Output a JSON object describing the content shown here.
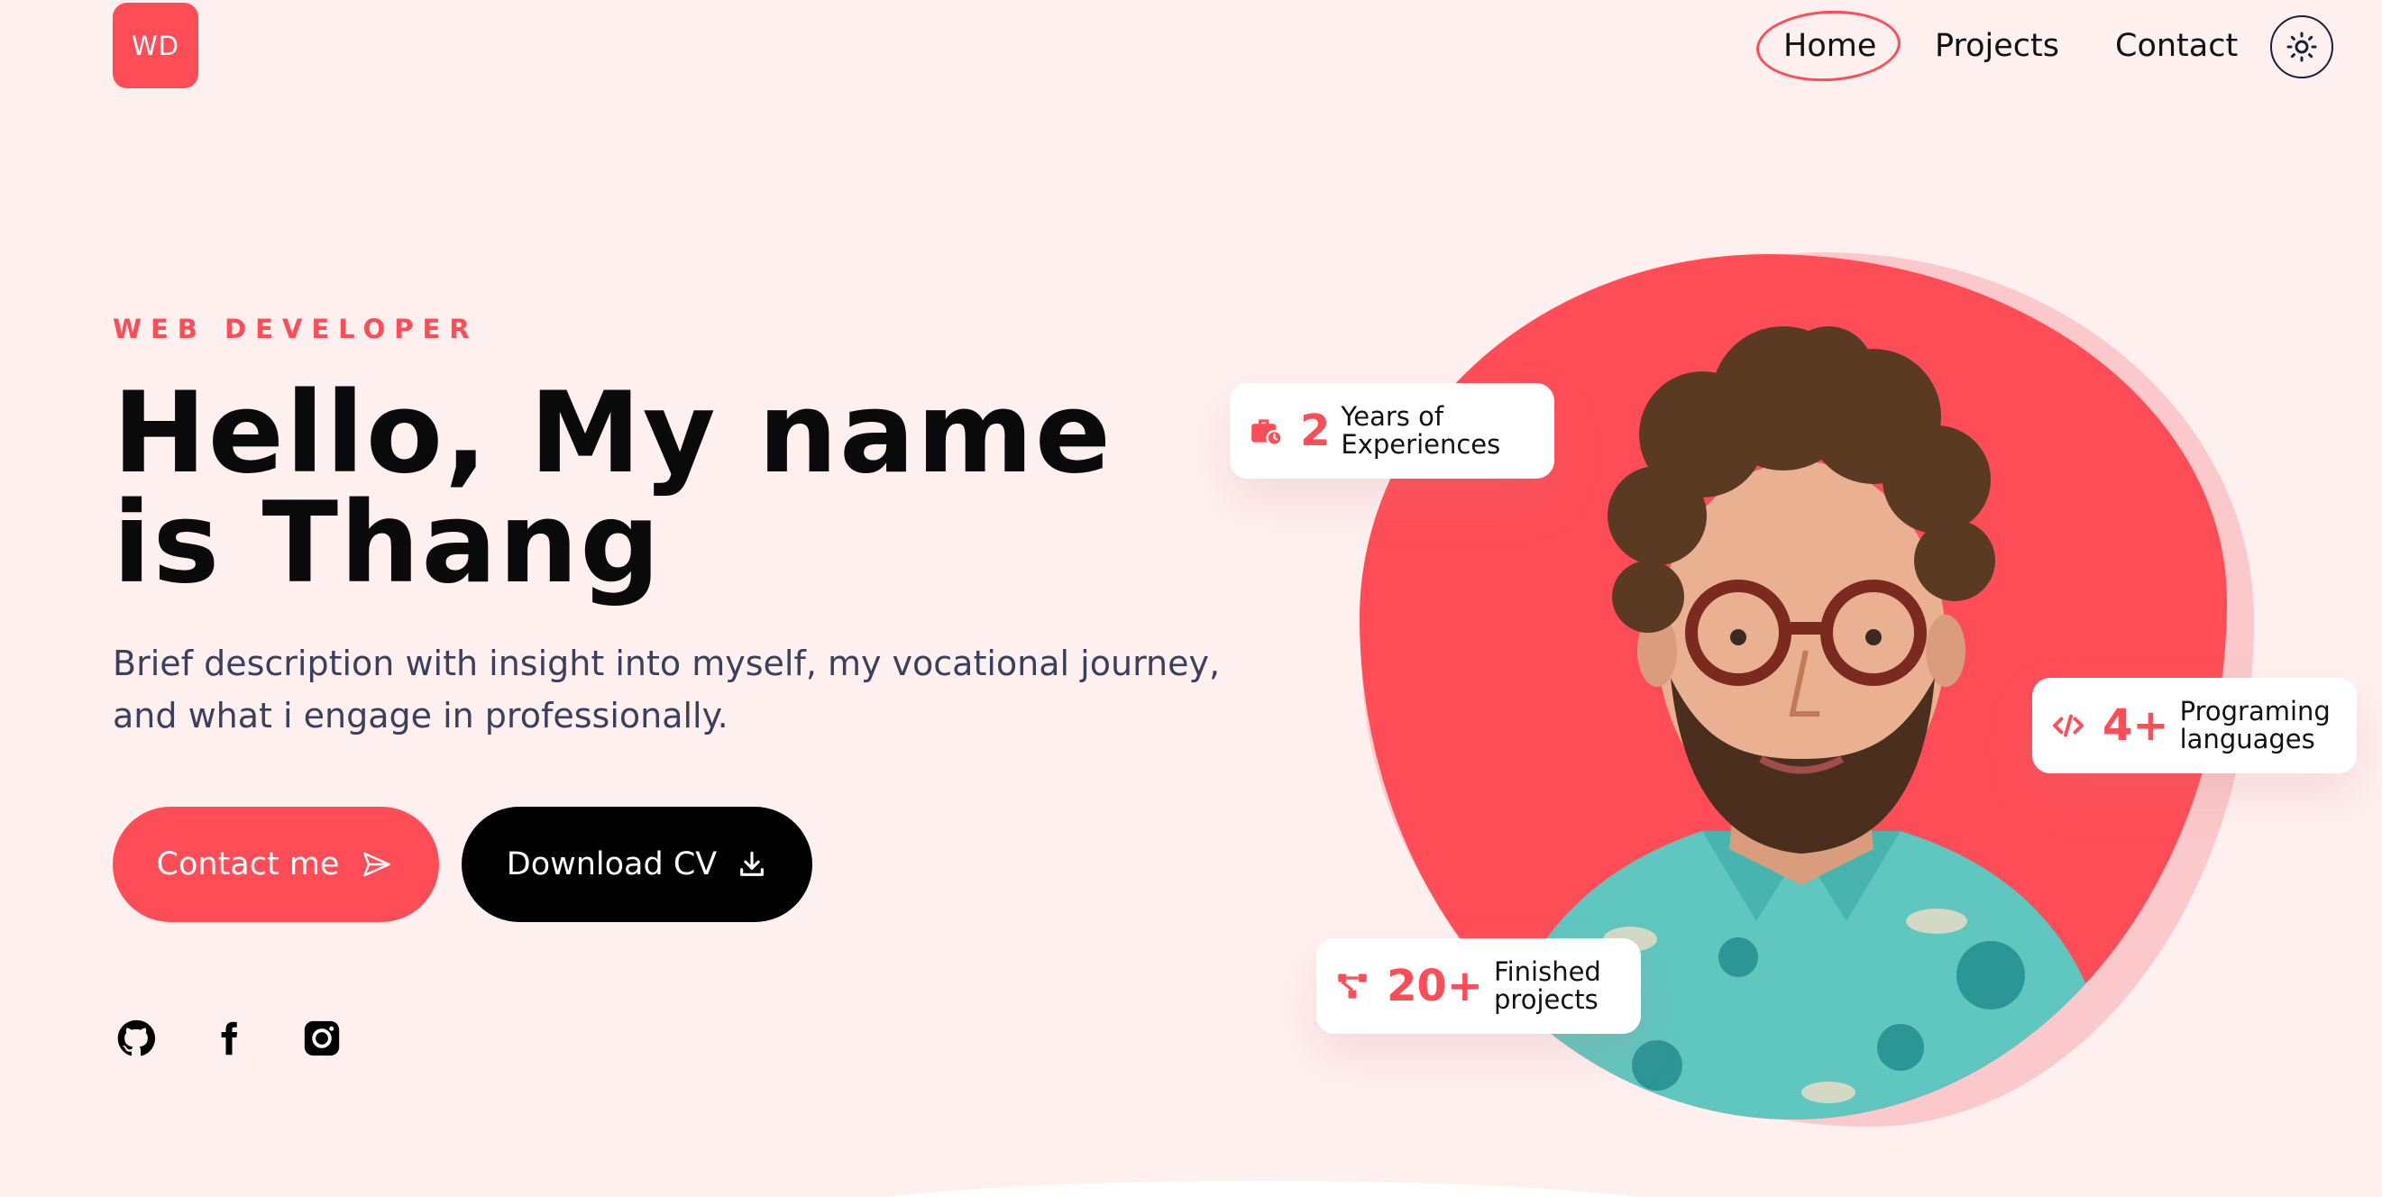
{
  "header": {
    "logo": "WD",
    "nav": [
      {
        "label": "Home",
        "active": true
      },
      {
        "label": "Projects"
      },
      {
        "label": "Contact"
      }
    ],
    "theme_icon": "sun-icon"
  },
  "hero": {
    "eyebrow": "WEB DEVELOPER",
    "headline_line1": "Hello, My name",
    "headline_line2": "is Thang",
    "description_line1": "Brief description with insight into myself, my vocational journey,",
    "description_line2": "and what i engage in professionally.",
    "buttons": {
      "contact": {
        "label": "Contact me",
        "icon": "paper-plane-icon"
      },
      "cv": {
        "label": "Download CV",
        "icon": "download-icon"
      }
    },
    "socials": [
      {
        "name": "github",
        "icon": "github-icon"
      },
      {
        "name": "facebook",
        "icon": "facebook-icon"
      },
      {
        "name": "instagram",
        "icon": "instagram-icon"
      }
    ]
  },
  "stats": {
    "experience": {
      "number": "2",
      "label_line1": "Years of",
      "label_line2": "Experiences",
      "icon": "briefcase-clock-icon"
    },
    "languages": {
      "number": "4+",
      "label_line1": "Programing",
      "label_line2": "languages",
      "icon": "code-icon"
    },
    "projects": {
      "number": "20+",
      "label_line1": "Finished",
      "label_line2": "projects",
      "icon": "network-icon"
    }
  },
  "colors": {
    "accent": "#ff4d57",
    "background": "#fff0f0",
    "dark": "#000000",
    "text_muted": "#3a3f5c"
  }
}
